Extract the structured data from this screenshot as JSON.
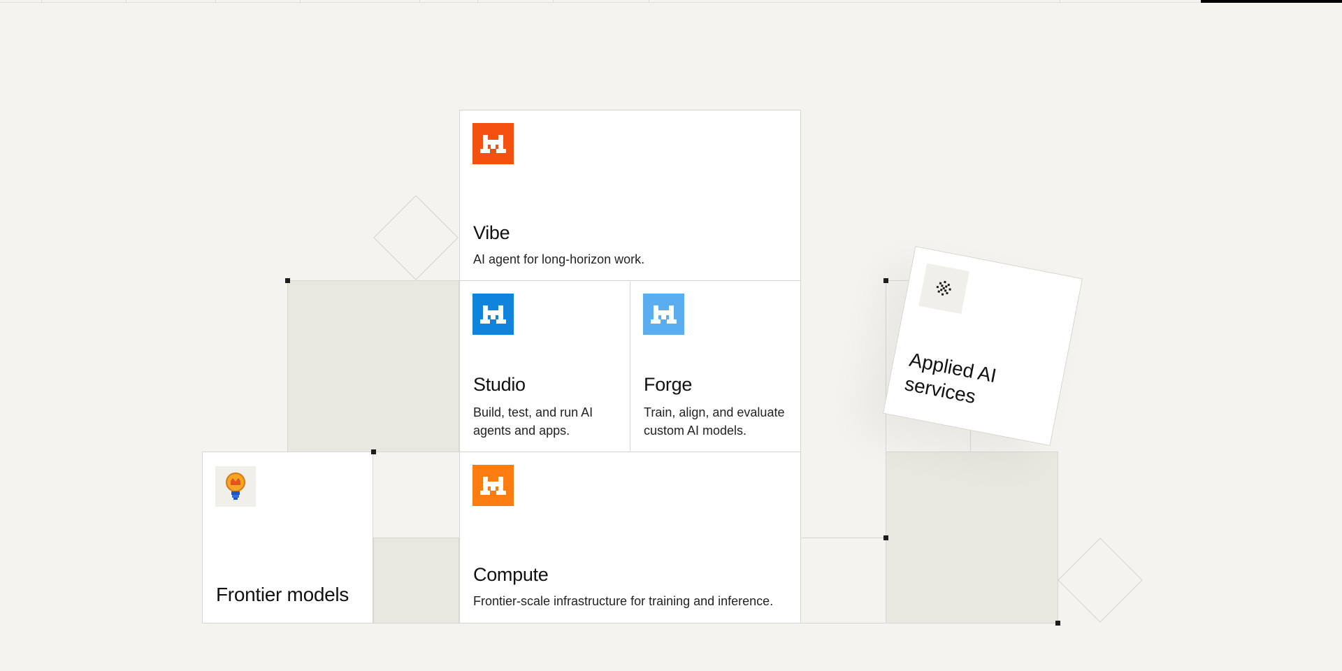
{
  "cards": {
    "vibe": {
      "title": "Vibe",
      "desc": "AI agent for long-horizon work."
    },
    "studio": {
      "title": "Studio",
      "desc": "Build, test, and run AI agents and apps."
    },
    "forge": {
      "title": "Forge",
      "desc": "Train, align, and evaluate custom AI models."
    },
    "compute": {
      "title": "Compute",
      "desc": "Frontier-scale infrastructure for training and inference."
    },
    "frontier": {
      "title": "Frontier models"
    },
    "applied": {
      "title": "Applied AI services"
    }
  },
  "icons": {
    "vibe": "mistral-m-orange-red-icon",
    "studio": "mistral-m-blue-icon",
    "forge": "mistral-m-light-blue-icon",
    "compute": "mistral-m-orange-icon",
    "frontier": "lightbulb-icon",
    "applied": "sparkle-dots-icon"
  },
  "colors": {
    "vibe": "#f4500f",
    "studio": "#1083dd",
    "forge": "#5aaef0",
    "compute": "#fb7c10",
    "background": "#f4f3ef",
    "cell_grey": "#e9e8e0"
  }
}
